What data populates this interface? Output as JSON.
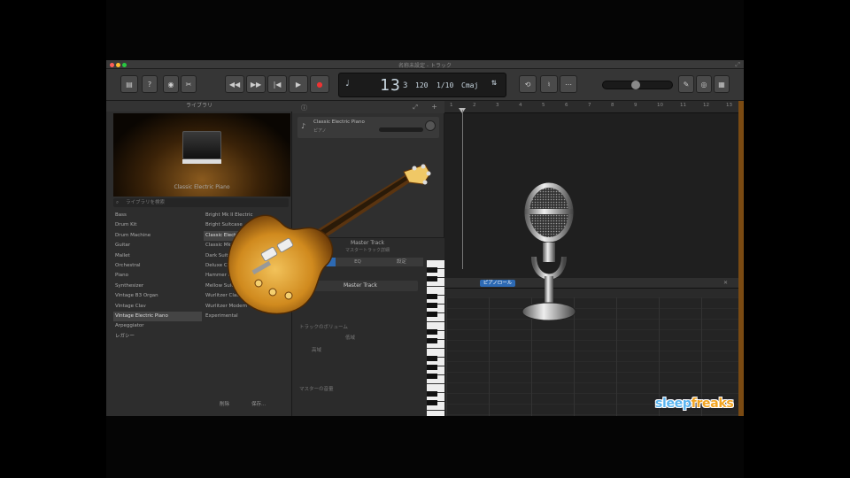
{
  "window": {
    "title": "名称未設定 - トラック"
  },
  "lcd": {
    "bar": "1",
    "beat": "3",
    "tick": "3",
    "tempo": "120",
    "time_sig": "1/10",
    "key": "Cmaj"
  },
  "library": {
    "title": "ライブラリ",
    "preview_label": "Classic Electric Piano",
    "search_placeholder": "ライブラリを検索",
    "categories": [
      "Bass",
      "Drum Kit",
      "Drum Machine",
      "Guitar",
      "Mallet",
      "Orchestral",
      "Piano",
      "Synthesizer",
      "Vintage B3 Organ",
      "Vintage Clav",
      "Vintage Electric Piano",
      "Arpeggiator",
      "レガシー"
    ],
    "selected_category_index": 10,
    "subpatches": [
      "Bright Mk II Electric",
      "Bright Suitcase",
      "Classic Electric Piano",
      "Classic Mk II",
      "Dark Suitcase",
      "Deluxe Classic",
      "Hammer Electric",
      "Mellow Suitcase",
      "Wurlitzer Classic",
      "Wurlitzer Modern",
      "Experimental"
    ],
    "selected_subpatch_index": 2,
    "footer_left": "削除",
    "footer_right": "保存..."
  },
  "inspector": {
    "patch_name": "Classic Electric Piano",
    "patch_sub": "ピアノ"
  },
  "smart_controls": {
    "track_name": "Master Track",
    "track_sub": "マスタートラック詳細",
    "tabs": [
      "コントロール",
      "EQ",
      "設定"
    ],
    "active_tab": 0,
    "master_button": "Master Track",
    "label_1": "トラックのボリューム",
    "label_2": "トラックの出力",
    "label_3": "マスターの音量",
    "value_1": "低域",
    "value_2": "高域"
  },
  "ruler": {
    "numbers": [
      "1",
      "2",
      "3",
      "4",
      "5",
      "6",
      "7",
      "8",
      "9",
      "10",
      "11",
      "12",
      "13"
    ]
  },
  "editor": {
    "tab_label": "ピアノロール"
  },
  "watermark": {
    "part1": "sleep",
    "part2": "freaks"
  },
  "colors": {
    "accent": "#2d6ab4",
    "frame": "#7a4a12",
    "watermark_blue": "#5ab4f0",
    "watermark_orange": "#f2a422"
  }
}
